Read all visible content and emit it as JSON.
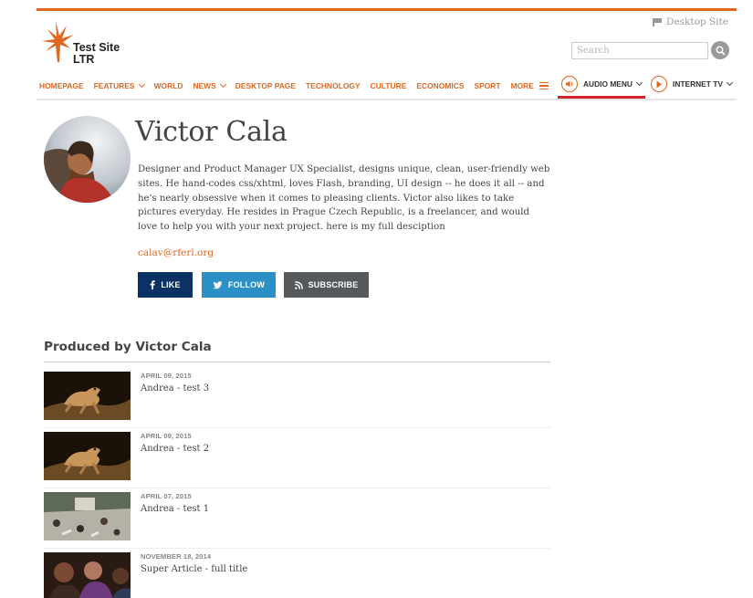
{
  "site": {
    "logo_line1": "Test Site",
    "logo_line2": "LTR",
    "desktop_site_label": "Desktop Site",
    "search_placeholder": "Search"
  },
  "nav": {
    "items": [
      "HOMEPAGE",
      "FEATURES",
      "WORLD",
      "NEWS",
      "DESKTOP PAGE",
      "TECHNOLOGY",
      "CULTURE",
      "ECONOMICS",
      "SPORT",
      "MORE"
    ],
    "audio_menu": "AUDIO MENU",
    "internet_tv": "INTERNET TV"
  },
  "author": {
    "name": "Victor Cala",
    "bio": "Designer and Product Manager UX Specialist, designs unique, clean, user-friendly web sites. He hand-codes css/xhtml, loves Flash, branding, UI design -- he does it all -- and he's nearly obsessive when it comes to pleasing clients. Victor also likes to take pictures everyday. He resides in Prague Czech Republic, is a freelancer, and would love to help you with your next project.  here is my full desciption",
    "email": "calav@rferl.org"
  },
  "social": {
    "like": "LIKE",
    "follow": "FOLLOW",
    "subscribe": "SUBSCRIBE"
  },
  "section_title": "Produced by Victor Cala",
  "articles": [
    {
      "date": "APRIL 09, 2015",
      "title": "Andrea - test 3"
    },
    {
      "date": "APRIL 09, 2015",
      "title": "Andrea - test 2"
    },
    {
      "date": "APRIL 07, 2015",
      "title": "Andrea - test 1"
    },
    {
      "date": "NOVEMBER 18, 2014",
      "title": "Super Article - full title"
    }
  ],
  "colors": {
    "accent": "#e0671f",
    "underline_red": "#d4232b",
    "facebook": "#0a3363",
    "twitter": "#2a90c6",
    "rss": "#55595c"
  }
}
